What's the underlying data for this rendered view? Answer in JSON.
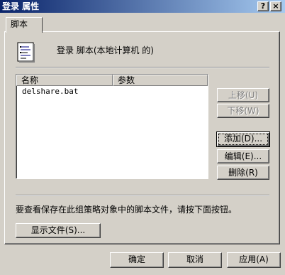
{
  "window": {
    "title": "登录 属性",
    "help_glyph": "?",
    "close_glyph": "×"
  },
  "tabs": [
    {
      "label": "脚本"
    }
  ],
  "header": {
    "description": "登录 脚本(本地计算机 的)"
  },
  "script_list": {
    "columns": [
      "名称",
      "参数"
    ],
    "rows": [
      {
        "name": "delshare.bat",
        "params": ""
      }
    ]
  },
  "side_buttons": {
    "move_up": "上移(U)",
    "move_down": "下移(W)",
    "add": "添加(D)...",
    "edit": "编辑(E)...",
    "remove": "删除(R)"
  },
  "footer": {
    "hint": "要查看保存在此组策略对象中的脚本文件，请按下面按钮。",
    "show_files": "显示文件(S)..."
  },
  "dialog_buttons": {
    "ok": "确定",
    "cancel": "取消",
    "apply": "应用(A)"
  },
  "colors": {
    "face": "#d4d0c8",
    "title_start": "#0a246a",
    "title_end": "#a6caf0"
  }
}
